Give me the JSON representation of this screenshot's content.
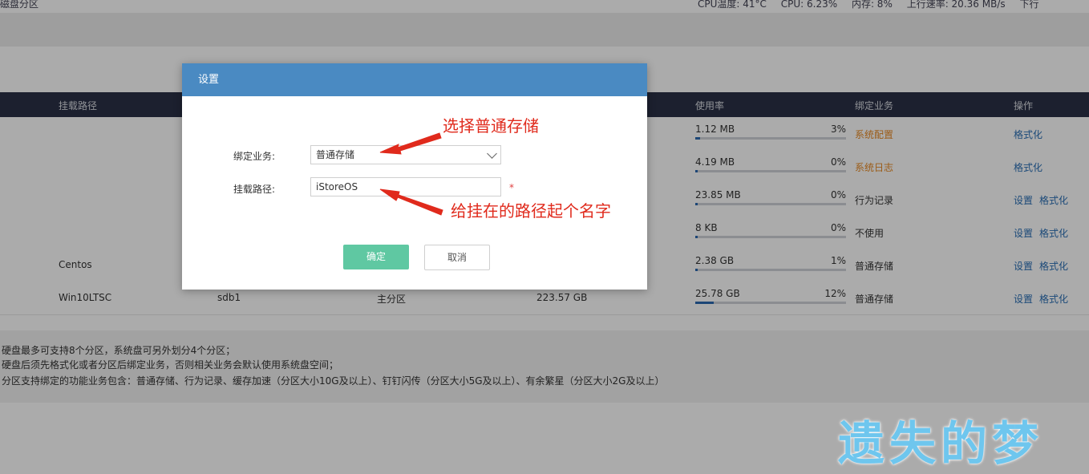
{
  "topbar": {
    "title": "磁盘分区",
    "cpu_temp": "CPU温度: 41°C",
    "cpu": "CPU: 6.23%",
    "memory": "内存: 8%",
    "upload": "上行速率: 20.36 MB/s",
    "download": "下行"
  },
  "table": {
    "headers": {
      "mount": "挂载路径",
      "usage": "使用率",
      "service": "绑定业务",
      "ops": "操作"
    },
    "rows": [
      {
        "mount": "",
        "device": "",
        "type": "",
        "capacity": "",
        "used": "1.12 MB",
        "pct": "3%",
        "fill": 0.03,
        "service": "系统配置",
        "service_style": "orange",
        "ops": [
          "格式化"
        ]
      },
      {
        "mount": "",
        "device": "",
        "type": "",
        "capacity": "",
        "used": "4.19 MB",
        "pct": "0%",
        "fill": 0.0,
        "service": "系统日志",
        "service_style": "orange",
        "ops": [
          "格式化"
        ]
      },
      {
        "mount": "",
        "device": "",
        "type": "",
        "capacity": "",
        "used": "23.85 MB",
        "pct": "0%",
        "fill": 0.0,
        "service": "行为记录",
        "service_style": "normal",
        "ops": [
          "设置",
          "格式化"
        ]
      },
      {
        "mount": "",
        "device": "",
        "type": "",
        "capacity": "",
        "used": "8 KB",
        "pct": "0%",
        "fill": 0.0,
        "service": "不使用",
        "service_style": "normal",
        "ops": [
          "设置",
          "格式化"
        ]
      },
      {
        "mount": "Centos",
        "device": "",
        "type": "",
        "capacity": "",
        "used": "2.38 GB",
        "pct": "1%",
        "fill": 0.01,
        "service": "普通存储",
        "service_style": "normal",
        "ops": [
          "设置",
          "格式化"
        ]
      },
      {
        "mount": "Win10LTSC",
        "device": "sdb1",
        "type": "主分区",
        "capacity": "223.57 GB",
        "used": "25.78 GB",
        "pct": "12%",
        "fill": 0.12,
        "service": "普通存储",
        "service_style": "normal",
        "ops": [
          "设置",
          "格式化"
        ]
      }
    ]
  },
  "notes": [
    "硬盘最多可支持8个分区，系统盘可另外划分4个分区；",
    "硬盘后须先格式化或者分区后绑定业务，否则相关业务会默认使用系统盘空间；",
    "分区支持绑定的功能业务包含：普通存储、行为记录、缓存加速（分区大小10G及以上）、钉钉闪传（分区大小5G及以上）、有余繁星（分区大小2G及以上）"
  ],
  "modal": {
    "title": "设置",
    "service_label": "绑定业务:",
    "service_value": "普通存储",
    "path_label": "挂载路径:",
    "path_value": "iStoreOS",
    "required_mark": "*",
    "confirm": "确定",
    "cancel": "取消"
  },
  "annotations": {
    "select_hint": "选择普通存储",
    "path_hint": "给挂在的路径起个名字"
  },
  "watermark": "遗失的梦",
  "colors": {
    "header_bg": "#2b3146",
    "modal_header": "#4a8ac2",
    "confirm_btn": "#5fc8a2",
    "link": "#2a6fb5",
    "orange_service": "#e88a24",
    "annotation_red": "#e02a1c",
    "watermark": "#6ec6ee"
  }
}
